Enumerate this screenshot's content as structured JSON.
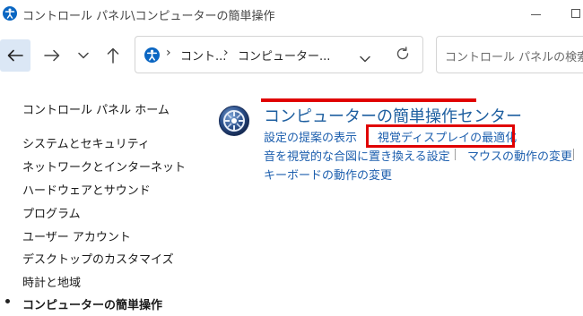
{
  "window": {
    "title": "コントロール パネル\\コンピューターの簡単操作"
  },
  "navbar": {
    "breadcrumbs": [
      "コント...",
      "コンピューター..."
    ],
    "search_placeholder": "コントロール パネルの検索"
  },
  "sidebar": {
    "home": "コントロール パネル ホーム",
    "items": [
      "システムとセキュリティ",
      "ネットワークとインターネット",
      "ハードウェアとサウンド",
      "プログラム",
      "ユーザー アカウント",
      "デスクトップのカスタマイズ",
      "時計と地域",
      "コンピューターの簡単操作"
    ]
  },
  "main": {
    "title": "コンピューターの簡単操作センター",
    "links": [
      "設定の提案の表示",
      "視覚ディスプレイの最適化",
      "音を視覚的な合図に置き換える設定",
      "マウスの動作の変更",
      "キーボードの動作の変更"
    ]
  },
  "colors": {
    "link": "#1d5fae",
    "title": "#1e5fa0",
    "annotation_red": "#e00000",
    "back_button_bg": "#dbe7f5"
  }
}
